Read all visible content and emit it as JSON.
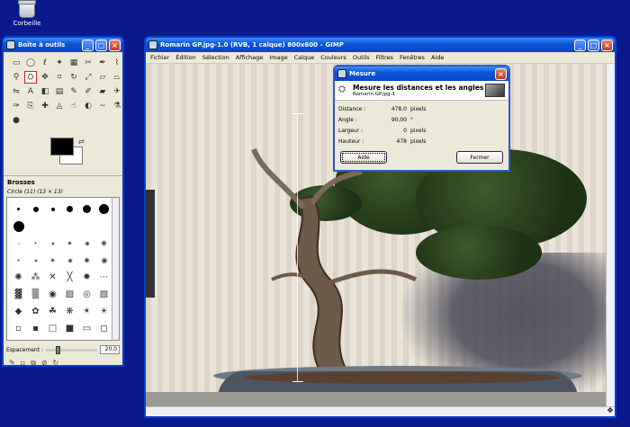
{
  "desktop": {
    "recycle_bin_label": "Corbeille"
  },
  "toolbox": {
    "title": "Boîte à outils",
    "brushes_label": "Brosses",
    "brush_name": "Circle (11) (13 × 13)",
    "spacing_label": "Espacement :",
    "spacing_value": "20,0",
    "spacing_level": 20
  },
  "image_window": {
    "title": "Romarin GP.jpg-1.0 (RVB, 1 calque) 800x600 – GIMP",
    "menu": [
      "Fichier",
      "Édition",
      "Sélection",
      "Affichage",
      "Image",
      "Calque",
      "Couleurs",
      "Outils",
      "Filtres",
      "Fenêtres",
      "Aide"
    ]
  },
  "measure_dialog": {
    "title": "Mesure",
    "heading": "Mesure les distances et les angles",
    "subheading": "Romarin GP.jpg-1",
    "rows": [
      {
        "label": "Distance :",
        "value": "478,0",
        "unit": "pixels"
      },
      {
        "label": "Angle :",
        "value": "90,00",
        "unit": "°"
      },
      {
        "label": "Largeur :",
        "value": "0",
        "unit": "pixels"
      },
      {
        "label": "Hauteur :",
        "value": "478",
        "unit": "pixels"
      }
    ],
    "help_button": "Aide",
    "close_button": "Fermer"
  },
  "icons": [
    "recycle-bin-icon",
    "gimp-icon",
    "minimize-icon",
    "maximize-icon",
    "close-icon",
    "measure-icon",
    "navigate-icon"
  ]
}
